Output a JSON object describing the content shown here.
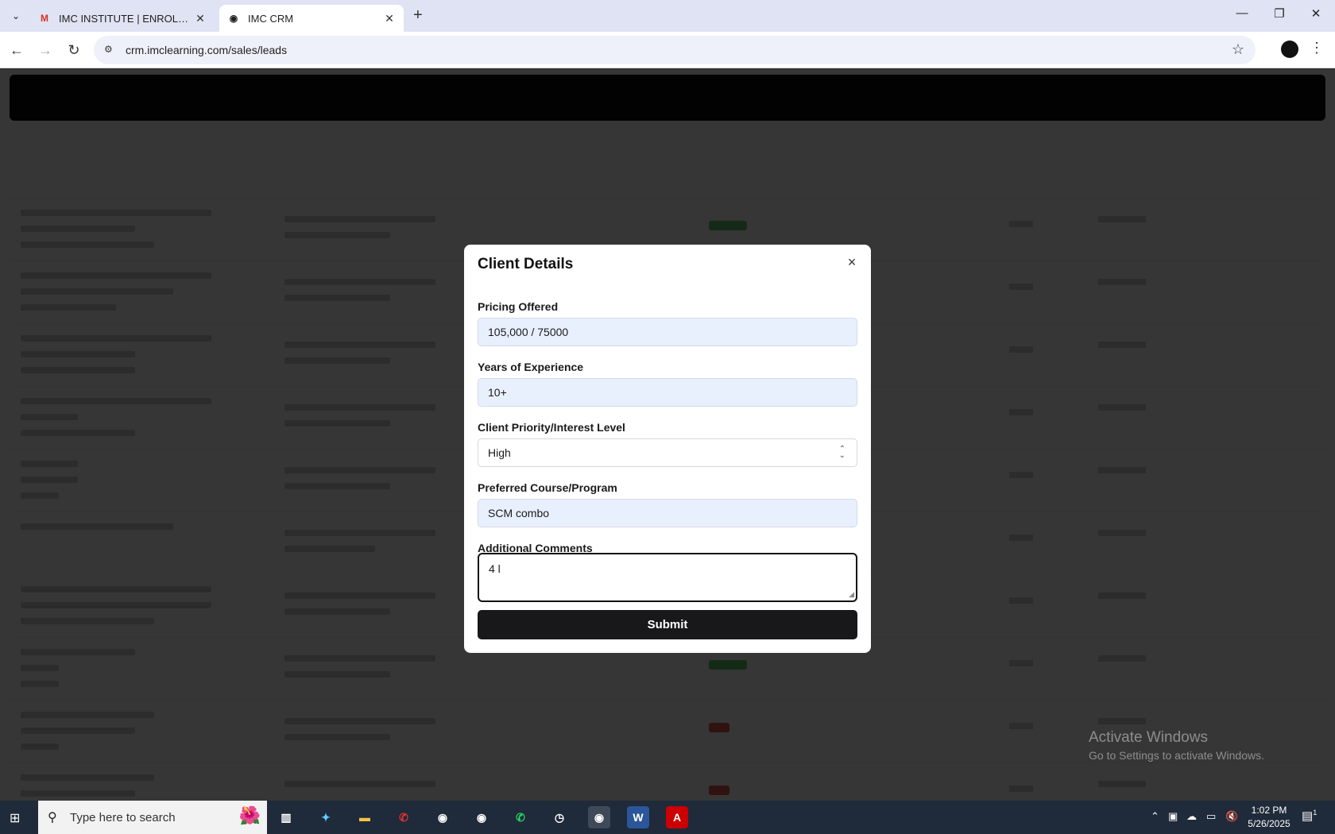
{
  "browser": {
    "tabs": [
      {
        "title": "IMC INSTITUTE | ENROLLMENT",
        "favicon": "M",
        "active": false
      },
      {
        "title": "IMC CRM",
        "favicon": "◉",
        "active": true
      }
    ],
    "url": "crm.imclearning.com/sales/leads"
  },
  "modal": {
    "title": "Client Details",
    "fields": {
      "pricing": {
        "label": "Pricing Offered",
        "value": "105,000 / 75000"
      },
      "experience": {
        "label": "Years of Experience",
        "value": "10+"
      },
      "priority": {
        "label": "Client Priority/Interest Level",
        "value": "High"
      },
      "course": {
        "label": "Preferred Course/Program",
        "value": "SCM combo"
      },
      "comments": {
        "label": "Additional Comments",
        "value": "4 l"
      }
    },
    "submit_label": "Submit",
    "close_icon": "×"
  },
  "watermark": {
    "line1": "Activate Windows",
    "line2": "Go to Settings to activate Windows."
  },
  "taskbar": {
    "search_placeholder": "Type here to search",
    "time": "1:02 PM",
    "date": "5/26/2025",
    "notification_count": "1"
  },
  "colors": {
    "accent": "#18181b",
    "input_bg": "#e8f0fe",
    "overlay": "rgba(0,0,0,0.78)"
  }
}
